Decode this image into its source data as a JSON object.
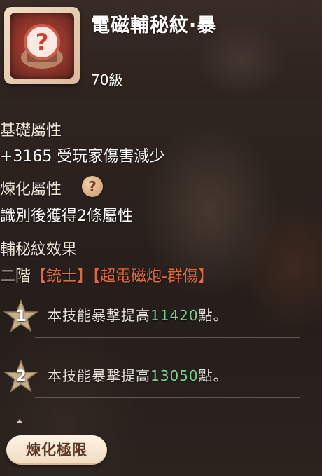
{
  "item": {
    "name": "電磁輔秘紋·暴",
    "level": "70級",
    "icon": "question-mark-seal-icon"
  },
  "base_attr": {
    "heading": "基礎屬性",
    "value": "+3165 受玩家傷害減少"
  },
  "refine_attr": {
    "heading": "煉化屬性",
    "help_icon": "question-help-icon",
    "description": "識別後獲得2條屬性"
  },
  "effect": {
    "heading": "輔秘紋效果",
    "tier_prefix": "二階",
    "tag1": "【銃士】",
    "tag2": "【超電磁炮-群傷】",
    "skills": [
      {
        "rank": "1",
        "text_before": "本技能暴擊提高",
        "value": "11420",
        "text_after": "點。"
      },
      {
        "rank": "2",
        "text_before": "本技能暴擊提高",
        "value": "13050",
        "text_after": "點。"
      }
    ]
  },
  "button": {
    "label": "煉化極限"
  },
  "colors": {
    "tag": "#e46a3d",
    "number": "#77d493",
    "text": "#ffffff"
  }
}
